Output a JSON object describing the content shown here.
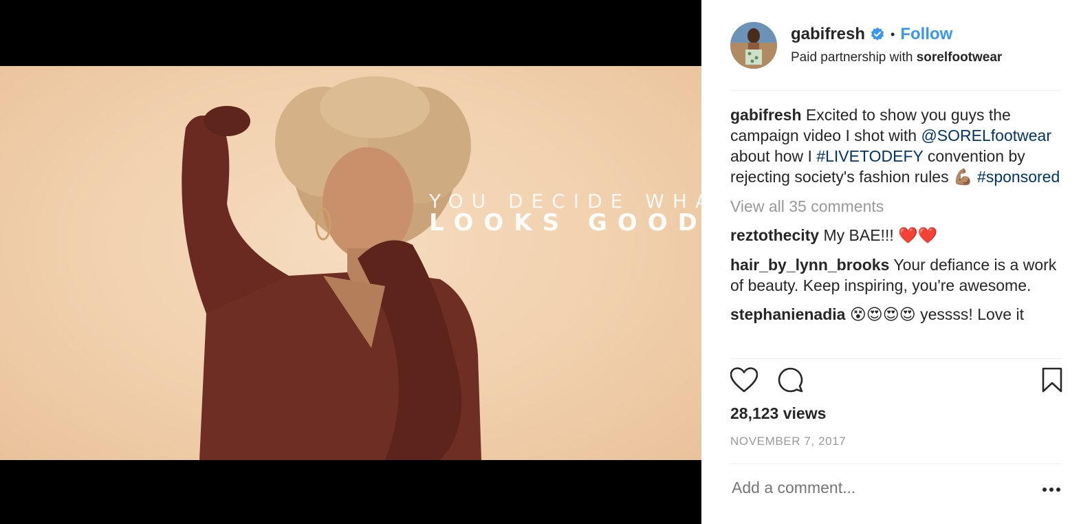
{
  "media": {
    "overlay_line1": "YOU DECIDE WHAT",
    "overlay_line2": "LOOKS GOOD"
  },
  "post": {
    "username": "gabifresh",
    "verified": true,
    "separator": "•",
    "follow_label": "Follow",
    "partnership_prefix": "Paid partnership with",
    "partner": "sorelfootwear"
  },
  "caption": {
    "username": "gabifresh",
    "text_1": "Excited to show you guys the campaign video I shot with",
    "mention": "@SORELfootwear",
    "text_2": "about how I",
    "hashtag_1": "#LIVETODEFY",
    "text_3": "convention by rejecting society's fashion rules",
    "emoji": "💪🏽",
    "hashtag_2": "#sponsored"
  },
  "view_all_comments": "View all 35 comments",
  "comments": [
    {
      "user": "reztothecity",
      "text": "My BAE!!!",
      "emoji": "❤️❤️"
    },
    {
      "user": "hair_by_lynn_brooks",
      "text": "Your defiance is a work of beauty. Keep inspiring, you're awesome.",
      "emoji": ""
    },
    {
      "user": "stephanienadia",
      "emoji": "😵😍😍😍",
      "text": "yessss! Love it"
    }
  ],
  "stats": {
    "views": "28,123 views",
    "date": "NOVEMBER 7, 2017"
  },
  "comment_box": {
    "placeholder": "Add a comment..."
  },
  "icons": {
    "like": "heart-icon",
    "comment": "comment-bubble-icon",
    "save": "bookmark-icon",
    "more": "more-options-icon",
    "verified": "verified-badge-icon"
  },
  "colors": {
    "link_blue": "#003569",
    "follow_blue": "#3897f0",
    "muted_gray": "#999999"
  }
}
